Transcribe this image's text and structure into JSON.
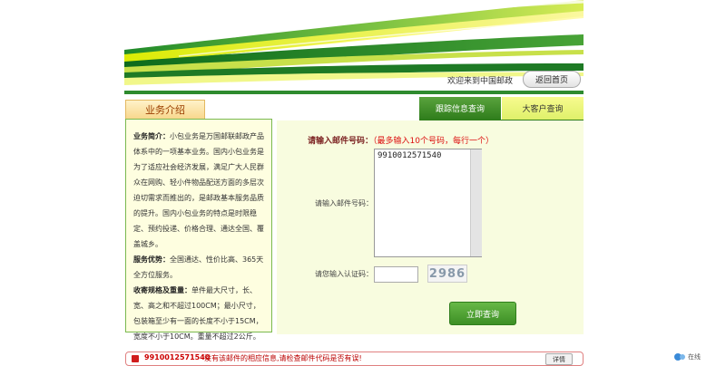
{
  "header": {
    "welcome_text": "欢迎来到中国邮政",
    "home_button": "返回首页"
  },
  "tabs": {
    "section_label": "业务介绍",
    "tracking": "跟踪信息查询",
    "big_customer": "大客户查询"
  },
  "intro": {
    "p1_title": "业务简介：",
    "p1_text": "小包业务是万国邮联邮政产品体系中的一项基本业务。国内小包业务是为了适应社会经济发展，满足广大人民群众在网购、轻小件物品配送方面的多层次迫切需求而推出的，是邮政基本服务品质的提升。国内小包业务的特点是时限稳定、预约投递、价格合理、通达全国、覆盖城乡。",
    "p2_title": "服务优势：",
    "p2_text": "全国通达、性价比高、365天全方位服务。",
    "p3_title": "收寄规格及重量：",
    "p3_text": "单件最大尺寸，长、宽、高之和不超过100CM；最小尺寸，包装箱至少有一面的长度不小于15CM，宽度不小于10CM。重量不超过2公斤。"
  },
  "query": {
    "title": "请输入邮件号码：",
    "note": "（最多输入10个号码，每行一个）",
    "number_label": "请输入邮件号码：",
    "number_value": "9910012571540",
    "captcha_label": "请您输入认证码：",
    "captcha_value": "",
    "captcha_code": "2986",
    "submit": "立即查询"
  },
  "result": {
    "number": "9910012571540",
    "message": "没有该邮件的相应信息,请检查邮件代码是否有误!",
    "detail_button": "详情"
  },
  "side_widget": {
    "label": "在线"
  },
  "colors": {
    "brand_green": "#2f7d1c",
    "accent_yellow": "#dff06a",
    "error_red": "#c00000"
  }
}
